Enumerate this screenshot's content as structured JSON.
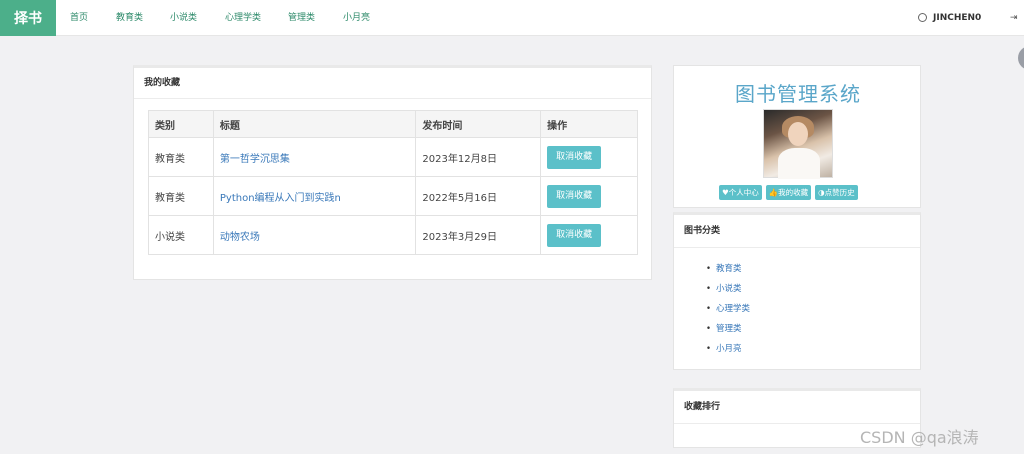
{
  "navbar": {
    "brand": "择书",
    "links": [
      "首页",
      "教育类",
      "小说类",
      "心理学类",
      "管理类",
      "小月亮"
    ],
    "username": "JINCHEN0",
    "logout_icon": "logout-icon"
  },
  "favorites": {
    "heading": "我的收藏",
    "columns": [
      "类别",
      "标题",
      "发布时间",
      "操作"
    ],
    "rows": [
      {
        "category": "教育类",
        "title": "第一哲学沉思集",
        "date": "2023年12月8日",
        "action": "取消收藏"
      },
      {
        "category": "教育类",
        "title": "Python编程从入门到实践n",
        "date": "2022年5月16日",
        "action": "取消收藏"
      },
      {
        "category": "小说类",
        "title": "动物农场",
        "date": "2023年3月29日",
        "action": "取消收藏"
      }
    ]
  },
  "profile": {
    "system_title": "图书管理系统",
    "buttons": [
      "♥个人中心",
      "👍我的收藏",
      "◑点赞历史"
    ]
  },
  "categories": {
    "heading": "图书分类",
    "items": [
      "教育类",
      "小说类",
      "心理学类",
      "管理类",
      "小月亮"
    ]
  },
  "ranking": {
    "heading": "收藏排行"
  },
  "watermark": "CSDN @qa浪涛",
  "colors": {
    "brand": "#4caf8a",
    "accent": "#5bc0c9",
    "link": "#3978b9"
  }
}
